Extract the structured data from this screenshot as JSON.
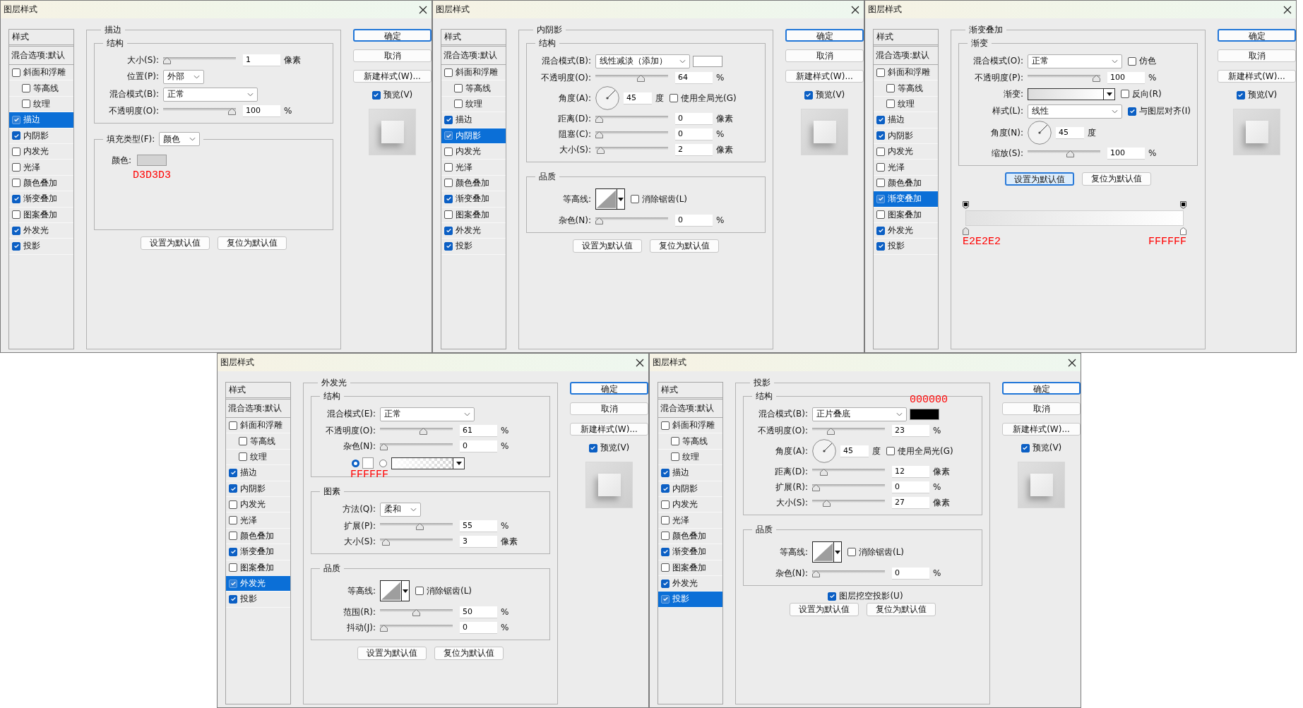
{
  "dialogs": [
    {
      "title": "图层样式",
      "sidebar": {
        "header": "样式",
        "blend_options": "混合选项:默认",
        "items": [
          {
            "label": "斜面和浮雕",
            "checked": false,
            "selected": false,
            "children": [
              {
                "label": "等高线",
                "checked": false,
                "selected": false
              },
              {
                "label": "纹理",
                "checked": false,
                "selected": false
              }
            ]
          },
          {
            "label": "描边",
            "checked": true,
            "selected": true
          },
          {
            "label": "内阴影",
            "checked": true,
            "selected": false
          },
          {
            "label": "内发光",
            "checked": false,
            "selected": false
          },
          {
            "label": "光泽",
            "checked": false,
            "selected": false
          },
          {
            "label": "颜色叠加",
            "checked": false,
            "selected": false
          },
          {
            "label": "渐变叠加",
            "checked": true,
            "selected": false
          },
          {
            "label": "图案叠加",
            "checked": false,
            "selected": false
          },
          {
            "label": "外发光",
            "checked": true,
            "selected": false
          },
          {
            "label": "投影",
            "checked": true,
            "selected": false
          }
        ]
      },
      "panel": {
        "title": "描边",
        "groups": [
          {
            "title": "结构",
            "rows": [
              {
                "kind": "slider",
                "label": "大小(S):",
                "level": 0,
                "value": "1",
                "unit": "像素"
              },
              {
                "kind": "select",
                "label": "位置(P):",
                "value": "外部",
                "compact": true
              },
              {
                "kind": "select",
                "label": "混合模式(B):",
                "value": "正常",
                "compact": false
              },
              {
                "kind": "slider",
                "label": "不透明度(O):",
                "level": 1,
                "value": "100",
                "unit": "%"
              }
            ]
          },
          {
            "legend_select": {
              "label": "填充类型(F):",
              "value": "颜色"
            },
            "rows": [
              {
                "kind": "color",
                "label": "颜色:",
                "swatch": {
                  "color": "#d3d3d3",
                  "code": "D3D3D3",
                  "code_above": false
                }
              }
            ]
          }
        ],
        "buttons": [
          {
            "label": "设置为默认值",
            "focused": false
          },
          {
            "label": "复位为默认值",
            "focused": false
          }
        ]
      },
      "actions": [
        {
          "label": "确定",
          "primary": true
        },
        {
          "label": "取消",
          "primary": false
        },
        {
          "label": "新建样式(W)...",
          "primary": false
        }
      ],
      "preview": {
        "label": "预览(V)",
        "checked": true
      }
    },
    {
      "title": "图层样式",
      "sidebar": {
        "header": "样式",
        "blend_options": "混合选项:默认",
        "items": [
          {
            "label": "斜面和浮雕",
            "checked": false,
            "selected": false,
            "children": [
              {
                "label": "等高线",
                "checked": false,
                "selected": false
              },
              {
                "label": "纹理",
                "checked": false,
                "selected": false
              }
            ]
          },
          {
            "label": "描边",
            "checked": true,
            "selected": false
          },
          {
            "label": "内阴影",
            "checked": true,
            "selected": true
          },
          {
            "label": "内发光",
            "checked": false,
            "selected": false
          },
          {
            "label": "光泽",
            "checked": false,
            "selected": false
          },
          {
            "label": "颜色叠加",
            "checked": false,
            "selected": false
          },
          {
            "label": "渐变叠加",
            "checked": true,
            "selected": false
          },
          {
            "label": "图案叠加",
            "checked": false,
            "selected": false
          },
          {
            "label": "外发光",
            "checked": true,
            "selected": false
          },
          {
            "label": "投影",
            "checked": true,
            "selected": false
          }
        ]
      },
      "panel": {
        "title": "内阴影",
        "groups": [
          {
            "title": "结构",
            "rows": [
              {
                "kind": "select",
                "label": "混合模式(B):",
                "value": "线性减淡（添加）",
                "compact": false,
                "swatch": {
                  "color": "#ffffff"
                }
              },
              {
                "kind": "slider",
                "label": "不透明度(O):",
                "level": 0.64,
                "value": "64",
                "unit": "%"
              },
              {
                "kind": "angle",
                "label": "角度(A):",
                "value": "45",
                "unit": "度",
                "option": {
                  "label": "使用全局光(G)",
                  "checked": false
                }
              },
              {
                "kind": "slider",
                "label": "距离(D):",
                "level": 0,
                "value": "0",
                "unit": "像素"
              },
              {
                "kind": "slider",
                "label": "阻塞(C):",
                "level": 0,
                "value": "0",
                "unit": "%"
              },
              {
                "kind": "slider",
                "label": "大小(S):",
                "level": 0.02,
                "value": "2",
                "unit": "像素"
              }
            ]
          },
          {
            "title": "品质",
            "rows": [
              {
                "kind": "contour",
                "label": "等高线:",
                "option": {
                  "label": "消除锯齿(L)",
                  "checked": false
                }
              },
              {
                "kind": "slider",
                "label": "杂色(N):",
                "level": 0,
                "value": "0",
                "unit": "%"
              }
            ]
          }
        ],
        "buttons": [
          {
            "label": "设置为默认值",
            "focused": false
          },
          {
            "label": "复位为默认值",
            "focused": false
          }
        ]
      },
      "actions": [
        {
          "label": "确定",
          "primary": true
        },
        {
          "label": "取消",
          "primary": false
        },
        {
          "label": "新建样式(W)...",
          "primary": false
        }
      ],
      "preview": {
        "label": "预览(V)",
        "checked": true
      }
    },
    {
      "title": "图层样式",
      "sidebar": {
        "header": "样式",
        "blend_options": "混合选项:默认",
        "items": [
          {
            "label": "斜面和浮雕",
            "checked": false,
            "selected": false,
            "children": [
              {
                "label": "等高线",
                "checked": false,
                "selected": false
              },
              {
                "label": "纹理",
                "checked": false,
                "selected": false
              }
            ]
          },
          {
            "label": "描边",
            "checked": true,
            "selected": false
          },
          {
            "label": "内阴影",
            "checked": true,
            "selected": false
          },
          {
            "label": "内发光",
            "checked": false,
            "selected": false
          },
          {
            "label": "光泽",
            "checked": false,
            "selected": false
          },
          {
            "label": "颜色叠加",
            "checked": false,
            "selected": false
          },
          {
            "label": "渐变叠加",
            "checked": true,
            "selected": true
          },
          {
            "label": "图案叠加",
            "checked": false,
            "selected": false
          },
          {
            "label": "外发光",
            "checked": true,
            "selected": false
          },
          {
            "label": "投影",
            "checked": true,
            "selected": false
          }
        ]
      },
      "panel": {
        "title": "渐变叠加",
        "groups": [
          {
            "title": "渐变",
            "rows": [
              {
                "kind": "select",
                "label": "混合模式(O):",
                "value": "正常",
                "compact": false,
                "option": {
                  "label": "仿色",
                  "checked": false
                }
              },
              {
                "kind": "slider",
                "label": "不透明度(P):",
                "level": 1,
                "value": "100",
                "unit": "%"
              },
              {
                "kind": "gradient",
                "label": "渐变:",
                "stops": [
                  {
                    "color": "#dcdcdc"
                  },
                  {
                    "color": "#ffffff"
                  }
                ],
                "option": {
                  "label": "反向(R)",
                  "checked": false
                }
              },
              {
                "kind": "select",
                "label": "样式(L):",
                "value": "线性",
                "compact": false,
                "option": {
                  "label": "与图层对齐(I)",
                  "checked": true
                }
              },
              {
                "kind": "angle",
                "label": "角度(N):",
                "value": "45",
                "unit": "度"
              },
              {
                "kind": "slider",
                "label": "缩放(S):",
                "level": 0.6,
                "value": "100",
                "unit": "%"
              }
            ]
          }
        ],
        "buttons": [
          {
            "label": "设置为默认值",
            "focused": true
          },
          {
            "label": "复位为默认值",
            "focused": false
          }
        ],
        "editor": {
          "stops": [
            {
              "color": "#e2e2e2",
              "code": "E2E2E2"
            },
            {
              "color": "#ffffff",
              "code": "FFFFFF"
            }
          ]
        }
      },
      "actions": [
        {
          "label": "确定",
          "primary": true
        },
        {
          "label": "取消",
          "primary": false
        },
        {
          "label": "新建样式(W)...",
          "primary": false
        }
      ],
      "preview": {
        "label": "预览(V)",
        "checked": true
      }
    },
    {
      "title": "图层样式",
      "sidebar": {
        "header": "样式",
        "blend_options": "混合选项:默认",
        "items": [
          {
            "label": "斜面和浮雕",
            "checked": false,
            "selected": false,
            "children": [
              {
                "label": "等高线",
                "checked": false,
                "selected": false
              },
              {
                "label": "纹理",
                "checked": false,
                "selected": false
              }
            ]
          },
          {
            "label": "描边",
            "checked": true,
            "selected": false
          },
          {
            "label": "内阴影",
            "checked": true,
            "selected": false
          },
          {
            "label": "内发光",
            "checked": false,
            "selected": false
          },
          {
            "label": "光泽",
            "checked": false,
            "selected": false
          },
          {
            "label": "颜色叠加",
            "checked": false,
            "selected": false
          },
          {
            "label": "渐变叠加",
            "checked": true,
            "selected": false
          },
          {
            "label": "图案叠加",
            "checked": false,
            "selected": false
          },
          {
            "label": "外发光",
            "checked": true,
            "selected": true
          },
          {
            "label": "投影",
            "checked": true,
            "selected": false
          }
        ]
      },
      "panel": {
        "title": "外发光",
        "groups": [
          {
            "title": "结构",
            "rows": [
              {
                "kind": "select",
                "label": "混合模式(E):",
                "value": "正常",
                "compact": false
              },
              {
                "kind": "slider",
                "label": "不透明度(O):",
                "level": 0.61,
                "value": "61",
                "unit": "%"
              },
              {
                "kind": "slider",
                "label": "杂色(N):",
                "level": 0,
                "value": "0",
                "unit": "%"
              },
              {
                "kind": "source",
                "options": [
                  {
                    "kind": "color",
                    "selected": true,
                    "swatch": {
                      "color": "#ffffff",
                      "code": "FFFFFF",
                      "code_above": false
                    }
                  },
                  {
                    "kind": "gradient",
                    "selected": false
                  }
                ]
              }
            ]
          },
          {
            "title": "图素",
            "rows": [
              {
                "kind": "select",
                "label": "方法(Q):",
                "value": "柔和",
                "compact": true
              },
              {
                "kind": "slider",
                "label": "扩展(P):",
                "level": 0.55,
                "value": "55",
                "unit": "%"
              },
              {
                "kind": "slider",
                "label": "大小(S):",
                "level": 0.03,
                "value": "3",
                "unit": "像素"
              }
            ]
          },
          {
            "title": "品质",
            "rows": [
              {
                "kind": "contour",
                "label": "等高线:",
                "option": {
                  "label": "消除锯齿(L)",
                  "checked": false
                }
              },
              {
                "kind": "slider",
                "label": "范围(R):",
                "level": 0.5,
                "value": "50",
                "unit": "%"
              },
              {
                "kind": "slider",
                "label": "抖动(J):",
                "level": 0,
                "value": "0",
                "unit": "%"
              }
            ]
          }
        ],
        "buttons": [
          {
            "label": "设置为默认值",
            "focused": false
          },
          {
            "label": "复位为默认值",
            "focused": false
          }
        ]
      },
      "actions": [
        {
          "label": "确定",
          "primary": true
        },
        {
          "label": "取消",
          "primary": false
        },
        {
          "label": "新建样式(W)...",
          "primary": false
        }
      ],
      "preview": {
        "label": "预览(V)",
        "checked": true
      }
    },
    {
      "title": "图层样式",
      "sidebar": {
        "header": "样式",
        "blend_options": "混合选项:默认",
        "items": [
          {
            "label": "斜面和浮雕",
            "checked": false,
            "selected": false,
            "children": [
              {
                "label": "等高线",
                "checked": false,
                "selected": false
              },
              {
                "label": "纹理",
                "checked": false,
                "selected": false
              }
            ]
          },
          {
            "label": "描边",
            "checked": true,
            "selected": false
          },
          {
            "label": "内阴影",
            "checked": true,
            "selected": false
          },
          {
            "label": "内发光",
            "checked": false,
            "selected": false
          },
          {
            "label": "光泽",
            "checked": false,
            "selected": false
          },
          {
            "label": "颜色叠加",
            "checked": false,
            "selected": false
          },
          {
            "label": "渐变叠加",
            "checked": true,
            "selected": false
          },
          {
            "label": "图案叠加",
            "checked": false,
            "selected": false
          },
          {
            "label": "外发光",
            "checked": true,
            "selected": false
          },
          {
            "label": "投影",
            "checked": true,
            "selected": true
          }
        ]
      },
      "panel": {
        "title": "投影",
        "groups": [
          {
            "title": "结构",
            "rows": [
              {
                "kind": "select",
                "label": "混合模式(B):",
                "value": "正片叠底",
                "compact": false,
                "swatch": {
                  "color": "#000000",
                  "code": "000000",
                  "code_above": true
                }
              },
              {
                "kind": "slider",
                "label": "不透明度(O):",
                "level": 0.23,
                "value": "23",
                "unit": "%"
              },
              {
                "kind": "angle",
                "label": "角度(A):",
                "value": "45",
                "unit": "度",
                "option": {
                  "label": "使用全局光(G)",
                  "checked": false
                }
              },
              {
                "kind": "slider",
                "label": "距离(D):",
                "level": 0.12,
                "value": "12",
                "unit": "像素"
              },
              {
                "kind": "slider",
                "label": "扩展(R):",
                "level": 0,
                "value": "0",
                "unit": "%"
              },
              {
                "kind": "slider",
                "label": "大小(S):",
                "level": 0.16,
                "value": "27",
                "unit": "像素"
              }
            ]
          },
          {
            "title": "品质",
            "rows": [
              {
                "kind": "contour",
                "label": "等高线:",
                "option": {
                  "label": "消除锯齿(L)",
                  "checked": false
                }
              },
              {
                "kind": "slider",
                "label": "杂色(N):",
                "level": 0,
                "value": "0",
                "unit": "%"
              }
            ]
          }
        ],
        "knockout": {
          "label": "图层挖空投影(U)",
          "checked": true
        },
        "buttons": [
          {
            "label": "设置为默认值",
            "focused": false
          },
          {
            "label": "复位为默认值",
            "focused": false
          }
        ]
      },
      "actions": [
        {
          "label": "确定",
          "primary": true
        },
        {
          "label": "取消",
          "primary": false
        },
        {
          "label": "新建样式(W)...",
          "primary": false
        }
      ],
      "preview": {
        "label": "预览(V)",
        "checked": true
      }
    }
  ]
}
